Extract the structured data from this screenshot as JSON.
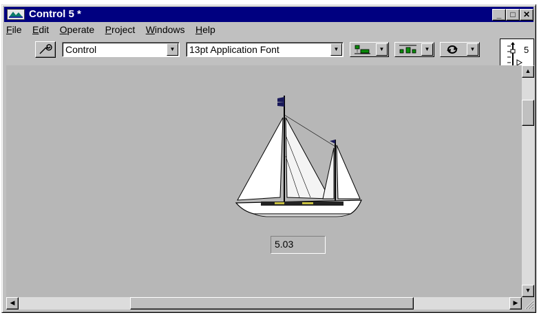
{
  "window": {
    "title": "Control 5 *",
    "icon": "labview-vi-icon",
    "controls": {
      "minimize": "_",
      "maximize": "□",
      "close": "✕"
    }
  },
  "menu": [
    {
      "label": "File"
    },
    {
      "label": "Edit"
    },
    {
      "label": "Operate"
    },
    {
      "label": "Project"
    },
    {
      "label": "Windows"
    },
    {
      "label": "Help"
    }
  ],
  "toolbar": {
    "control_type": "Control",
    "font": "13pt Application Font",
    "align_icon": "align-objects-icon",
    "distribute_icon": "distribute-objects-icon",
    "reorder_icon": "reorder-icon"
  },
  "connector_pane": {
    "count": "5"
  },
  "indicator": {
    "value": "5.03"
  },
  "colors": {
    "titlebar": "#000080",
    "panel": "#b7b7b7",
    "chrome": "#c0c0c0"
  }
}
